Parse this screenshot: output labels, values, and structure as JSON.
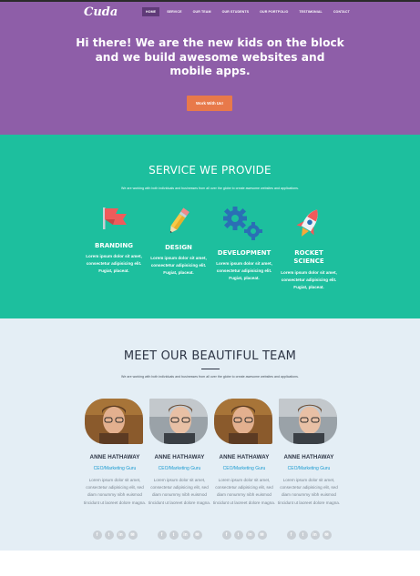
{
  "header": {
    "logo": "Cuda",
    "nav": [
      "HOME",
      "SERVICE",
      "OUR TEAM",
      "OUR STUDENTS",
      "OUR PORTFOLIO",
      "TESTIMONIAL",
      "CONTACT"
    ],
    "active_nav": "HOME"
  },
  "hero": {
    "title": "Hi there! We are the new kids on the block and we build awesome websites and mobile apps.",
    "cta_label": "Work With Us!"
  },
  "services": {
    "title": "SERVICE WE PROVIDE",
    "subtitle": "We are working with both individuals and businesses from all over the globe to create awesome websites and applications.",
    "items": [
      {
        "title": "BRANDING",
        "icon": "flag-icon",
        "text": "Lorem ipsum dolor sit amet, consectetur adipisicing elit. Fugiat, placeat."
      },
      {
        "title": "DESIGN",
        "icon": "pencil-icon",
        "text": "Lorem ipsum dolor sit amet, consectetur adipisicing elit. Fugiat, placeat."
      },
      {
        "title": "DEVELOPMENT",
        "icon": "gears-icon",
        "text": "Lorem ipsum dolor sit amet, consectetur adipisicing elit. Fugiat, placeat."
      },
      {
        "title": "ROCKET SCIENCE",
        "icon": "rocket-icon",
        "text": "Lorem ipsum dolor sit amet, consectetur adipisicing elit. Fugiat, placeat."
      }
    ]
  },
  "team": {
    "title": "MEET OUR BEAUTIFUL TEAM",
    "subtitle": "We are working with both individuals and businesses from all over the globe to create awesome websites and applications.",
    "members": [
      {
        "name": "ANNE HATHAWAY",
        "role": "CEO/Marketing Guru",
        "text": "Lorem ipsum dolor sit amet, consectetur adipisicing elit, sed diam nonummy nibh euismod tincidunt ut laoreet dolore magna."
      },
      {
        "name": "ANNE HATHAWAY",
        "role": "CEO/Marketing Guru",
        "text": "Lorem ipsum dolor sit amet, consectetur adipisicing elit, sed diam nonummy nibh euismod tincidunt ut laoreet dolore magna."
      },
      {
        "name": "ANNE HATHAWAY",
        "role": "CEO/Marketing Guru",
        "text": "Lorem ipsum dolor sit amet, consectetur adipisicing elit, sed diam nonummy nibh euismod tincidunt ut laoreet dolore magna."
      },
      {
        "name": "ANNE HATHAWAY",
        "role": "CEO/Marketing Guru",
        "text": "Lorem ipsum dolor sit amet, consectetur adipisicing elit, sed diam nonummy nibh euismod tincidunt ut laoreet dolore magna."
      }
    ],
    "social_icons": [
      "facebook-icon",
      "twitter-icon",
      "linkedin-icon",
      "email-icon"
    ]
  },
  "colors": {
    "hero_bg": "#8e5ea8",
    "services_bg": "#1dbf9e",
    "team_bg": "#e4eef5",
    "cta": "#e8794a",
    "role_link": "#1a9bd1"
  }
}
